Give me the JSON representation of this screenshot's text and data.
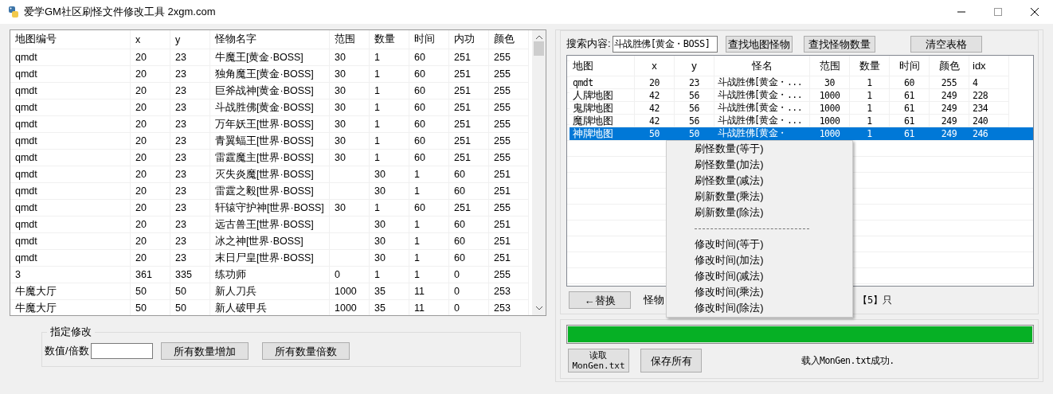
{
  "window": {
    "title": "爱学GM社区刷怪文件修改工具 2xgm.com"
  },
  "monster_table": {
    "columns": [
      "地图编号",
      "x",
      "y",
      "怪物名字",
      "范围",
      "数量",
      "时间",
      "内功",
      "颜色"
    ],
    "rows": [
      [
        "qmdt",
        "20",
        "23",
        "牛魔王[黄金·BOSS]",
        "30",
        "1",
        "60",
        "251",
        "255"
      ],
      [
        "qmdt",
        "20",
        "23",
        "独角魔王[黄金·BOSS]",
        "30",
        "1",
        "60",
        "251",
        "255"
      ],
      [
        "qmdt",
        "20",
        "23",
        "巨斧战神[黄金·BOSS]",
        "30",
        "1",
        "60",
        "251",
        "255"
      ],
      [
        "qmdt",
        "20",
        "23",
        "斗战胜佛[黄金·BOSS]",
        "30",
        "1",
        "60",
        "251",
        "255"
      ],
      [
        "qmdt",
        "20",
        "23",
        "万年妖王[世界·BOSS]",
        "30",
        "1",
        "60",
        "251",
        "255"
      ],
      [
        "qmdt",
        "20",
        "23",
        "青翼蝠王[世界·BOSS]",
        "30",
        "1",
        "60",
        "251",
        "255"
      ],
      [
        "qmdt",
        "20",
        "23",
        "雷霆魔主[世界·BOSS]",
        "30",
        "1",
        "60",
        "251",
        "255"
      ],
      [
        "qmdt",
        "20",
        "23",
        "灭失炎魔[世界·BOSS]",
        null,
        "30",
        "1",
        "60",
        "251"
      ],
      [
        "qmdt",
        "20",
        "23",
        "雷霆之毅[世界·BOSS]",
        null,
        "30",
        "1",
        "60",
        "251"
      ],
      [
        "qmdt",
        "20",
        "23",
        "轩辕守护神[世界·BOSS]",
        "30",
        "1",
        "60",
        "251",
        "255"
      ],
      [
        "qmdt",
        "20",
        "23",
        "远古兽王[世界·BOSS]",
        null,
        "30",
        "1",
        "60",
        "251"
      ],
      [
        "qmdt",
        "20",
        "23",
        "冰之神[世界·BOSS]",
        null,
        "30",
        "1",
        "60",
        "251"
      ],
      [
        "qmdt",
        "20",
        "23",
        "末日尸皇[世界·BOSS]",
        null,
        "30",
        "1",
        "60",
        "251"
      ],
      [
        "3",
        "361",
        "335",
        "练功师",
        "0",
        "1",
        "1",
        "0",
        "255"
      ],
      [
        "牛魔大厅",
        "50",
        "50",
        "新人刀兵",
        "1000",
        "35",
        "11",
        "0",
        "253"
      ],
      [
        "牛魔大厅",
        "50",
        "50",
        "新人破甲兵",
        "1000",
        "35",
        "11",
        "0",
        "253"
      ]
    ]
  },
  "batch_edit": {
    "title": "指定修改",
    "label": "数值/倍数",
    "buttons": [
      "所有数量增加",
      "所有数量倍数"
    ]
  },
  "search": {
    "label": "搜索内容:",
    "value": "斗战胜佛[黄金・BOSS]",
    "buttons": [
      "查找地图怪物",
      "查找怪物数量",
      "清空表格"
    ]
  },
  "results_table": {
    "columns": [
      "地图",
      "x",
      "y",
      "怪名",
      "范围",
      "数量",
      "时间",
      "颜色",
      "idx"
    ],
    "rows": [
      {
        "cells": [
          "qmdt",
          "20",
          "23",
          "斗战胜佛[黄金・...",
          "30",
          "1",
          "60",
          "255",
          "4"
        ],
        "selected": false
      },
      {
        "cells": [
          "人牌地图",
          "42",
          "56",
          "斗战胜佛[黄金・...",
          "1000",
          "1",
          "61",
          "249",
          "228"
        ],
        "selected": false
      },
      {
        "cells": [
          "鬼牌地图",
          "42",
          "56",
          "斗战胜佛[黄金・...",
          "1000",
          "1",
          "61",
          "249",
          "234"
        ],
        "selected": false
      },
      {
        "cells": [
          "魔牌地图",
          "42",
          "56",
          "斗战胜佛[黄金・...",
          "1000",
          "1",
          "61",
          "249",
          "240"
        ],
        "selected": false
      },
      {
        "cells": [
          "神牌地图",
          "50",
          "50",
          "斗战胜佛[黄金・",
          "1000",
          "1",
          "61",
          "249",
          "246"
        ],
        "selected": true
      }
    ]
  },
  "replace_button": "←替换",
  "count_label": "怪物",
  "count_value": "【5】只",
  "progress": {
    "level": 1
  },
  "file_buttons": [
    "读取\nMonGen.txt",
    "保存所有"
  ],
  "status": "载入MonGen.txt成功.",
  "context_menu": {
    "items": [
      {
        "kind": "item",
        "label": "刷怪数量(等于)"
      },
      {
        "kind": "item",
        "label": "刷怪数量(加法)"
      },
      {
        "kind": "item",
        "label": "刷怪数量(减法)"
      },
      {
        "kind": "item",
        "label": "刷新数量(乘法)"
      },
      {
        "kind": "item",
        "label": "刷新数量(除法)"
      },
      {
        "kind": "separator"
      },
      {
        "kind": "item",
        "label": "修改时间(等于)"
      },
      {
        "kind": "item",
        "label": "修改时间(加法)"
      },
      {
        "kind": "item",
        "label": "修改时间(减法)"
      },
      {
        "kind": "item",
        "label": "修改时间(乘法)"
      },
      {
        "kind": "item",
        "label": "修改时间(除法)"
      }
    ]
  }
}
